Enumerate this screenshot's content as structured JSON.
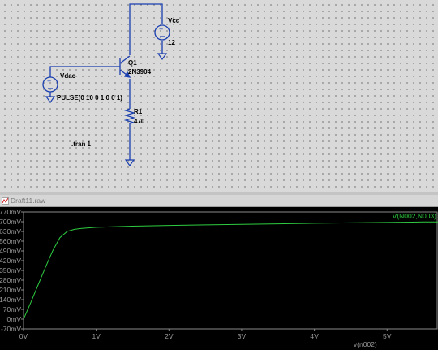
{
  "schematic": {
    "components": {
      "q1": {
        "ref": "Q1",
        "model": "2N3904"
      },
      "vcc": {
        "ref": "Vcc",
        "value": "12"
      },
      "vdac": {
        "ref": "Vdac",
        "value": "PULSE(0 10 0 1 0 0 1)"
      },
      "r1": {
        "ref": "R1",
        "value": "470"
      }
    },
    "directive": ".tran 1"
  },
  "waveform_window": {
    "title": "Draft11.raw",
    "trace_label": "V(N002,N003)",
    "trace_color": "#2ecc40",
    "grid_color": "#2a2a2a",
    "x_axis_title": "v(n002)"
  },
  "chart_data": {
    "type": "line",
    "xlabel": "v(n002)",
    "ylabel": "",
    "xlim": [
      0,
      5.7
    ],
    "ylim": [
      -70,
      770
    ],
    "y_ticks": [
      "770mV",
      "700mV",
      "630mV",
      "560mV",
      "490mV",
      "420mV",
      "350mV",
      "280mV",
      "210mV",
      "140mV",
      "70mV",
      "0mV",
      "-70mV"
    ],
    "x_ticks": [
      "0V",
      "1V",
      "2V",
      "3V",
      "4V",
      "5V"
    ],
    "series": [
      {
        "name": "V(N002,N003)",
        "x": [
          0,
          0.1,
          0.2,
          0.3,
          0.4,
          0.5,
          0.6,
          0.7,
          0.8,
          1.0,
          1.5,
          2.0,
          2.5,
          3.0,
          3.5,
          4.0,
          4.5,
          5.0,
          5.5,
          5.7
        ],
        "y": [
          0,
          120,
          245,
          370,
          490,
          585,
          630,
          645,
          652,
          660,
          668,
          673,
          677,
          681,
          685,
          689,
          692,
          695,
          698,
          699
        ]
      }
    ]
  }
}
